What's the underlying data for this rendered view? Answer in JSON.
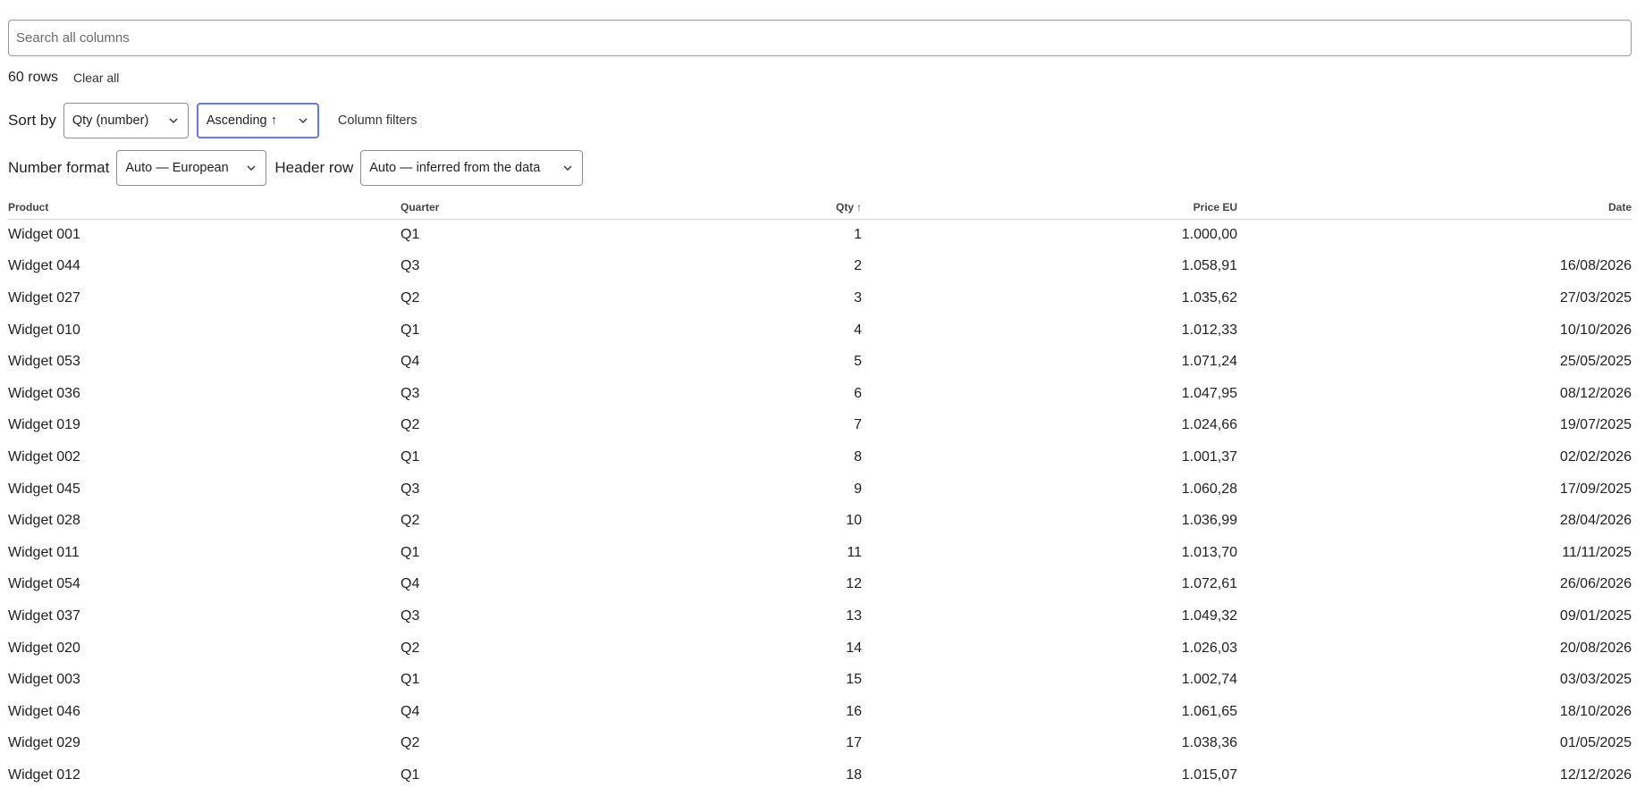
{
  "search": {
    "placeholder": "Search all columns",
    "value": ""
  },
  "summary": {
    "row_count": "60 rows",
    "clear_label": "Clear all"
  },
  "sort": {
    "label": "Sort by",
    "column_value": "Qty (number)",
    "direction_value": "Ascending ↑",
    "filters_label": "Column filters"
  },
  "format": {
    "number_label": "Number format",
    "number_value": "Auto — European",
    "header_label": "Header row",
    "header_value": "Auto — inferred from the data"
  },
  "icons": {
    "select_chevron": "chevron-down-icon"
  },
  "colors": {
    "focus_border": "#6b79e8",
    "text": "#222222"
  },
  "table": {
    "headers": {
      "product": "Product",
      "quarter": "Quarter",
      "qty": "Qty",
      "qty_sort": "↑",
      "price": "Price EU",
      "date": "Date"
    },
    "rows": [
      {
        "product": "Widget 001",
        "quarter": "Q1",
        "qty": "1",
        "price": "1.000,00",
        "date": ""
      },
      {
        "product": "Widget 044",
        "quarter": "Q3",
        "qty": "2",
        "price": "1.058,91",
        "date": "16/08/2026"
      },
      {
        "product": "Widget 027",
        "quarter": "Q2",
        "qty": "3",
        "price": "1.035,62",
        "date": "27/03/2025"
      },
      {
        "product": "Widget 010",
        "quarter": "Q1",
        "qty": "4",
        "price": "1.012,33",
        "date": "10/10/2026"
      },
      {
        "product": "Widget 053",
        "quarter": "Q4",
        "qty": "5",
        "price": "1.071,24",
        "date": "25/05/2025"
      },
      {
        "product": "Widget 036",
        "quarter": "Q3",
        "qty": "6",
        "price": "1.047,95",
        "date": "08/12/2026"
      },
      {
        "product": "Widget 019",
        "quarter": "Q2",
        "qty": "7",
        "price": "1.024,66",
        "date": "19/07/2025"
      },
      {
        "product": "Widget 002",
        "quarter": "Q1",
        "qty": "8",
        "price": "1.001,37",
        "date": "02/02/2026"
      },
      {
        "product": "Widget 045",
        "quarter": "Q3",
        "qty": "9",
        "price": "1.060,28",
        "date": "17/09/2025"
      },
      {
        "product": "Widget 028",
        "quarter": "Q2",
        "qty": "10",
        "price": "1.036,99",
        "date": "28/04/2026"
      },
      {
        "product": "Widget 011",
        "quarter": "Q1",
        "qty": "11",
        "price": "1.013,70",
        "date": "11/11/2025"
      },
      {
        "product": "Widget 054",
        "quarter": "Q4",
        "qty": "12",
        "price": "1.072,61",
        "date": "26/06/2026"
      },
      {
        "product": "Widget 037",
        "quarter": "Q3",
        "qty": "13",
        "price": "1.049,32",
        "date": "09/01/2025"
      },
      {
        "product": "Widget 020",
        "quarter": "Q2",
        "qty": "14",
        "price": "1.026,03",
        "date": "20/08/2026"
      },
      {
        "product": "Widget 003",
        "quarter": "Q1",
        "qty": "15",
        "price": "1.002,74",
        "date": "03/03/2025"
      },
      {
        "product": "Widget 046",
        "quarter": "Q4",
        "qty": "16",
        "price": "1.061,65",
        "date": "18/10/2026"
      },
      {
        "product": "Widget 029",
        "quarter": "Q2",
        "qty": "17",
        "price": "1.038,36",
        "date": "01/05/2025"
      },
      {
        "product": "Widget 012",
        "quarter": "Q1",
        "qty": "18",
        "price": "1.015,07",
        "date": "12/12/2026"
      }
    ]
  }
}
